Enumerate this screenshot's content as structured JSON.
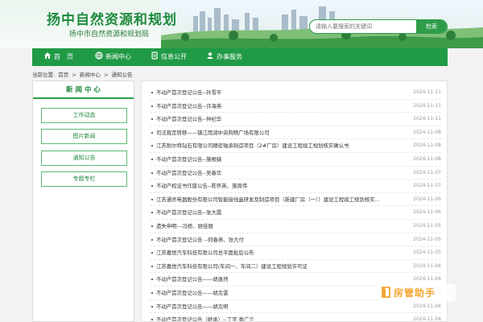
{
  "header": {
    "site_title": "扬中自然资源和规划",
    "site_subtitle": "扬中市自然资源和规划局"
  },
  "search": {
    "placeholder": "请输入要搜索的关键词",
    "button_label": "检索"
  },
  "nav": {
    "items": [
      {
        "label": "首　页",
        "icon": "home-icon"
      },
      {
        "label": "新闻中心",
        "icon": "globe-icon"
      },
      {
        "label": "信息公开",
        "icon": "document-icon"
      },
      {
        "label": "办事服务",
        "icon": "user-icon"
      }
    ]
  },
  "breadcrumb": {
    "prefix": "当前位置:",
    "items": [
      "首页",
      "新闻中心",
      "通知公告"
    ],
    "separator": ">"
  },
  "sidebar": {
    "title": "新 闻 中 心",
    "items": [
      "工作动态",
      "图片新闻",
      "通知公告",
      "专题专栏"
    ]
  },
  "list": {
    "items": [
      {
        "title": "不动产首次登记公告--孙雪平",
        "date": "2024-11-11"
      },
      {
        "title": "不动产首次登记公告--许海燕",
        "date": "2024-11-11"
      },
      {
        "title": "不动产首次登记公告--仲纪华",
        "date": "2024-11-11"
      },
      {
        "title": "司法裁定转移——镇江雨润中央购物广场有限公司",
        "date": "2024-11-08"
      },
      {
        "title": "江苏耐尔特钻石有限公司精密轴承制造项目（2#厂房）建设工程竣工规划核实确认书",
        "date": "2024-11-08"
      },
      {
        "title": "不动产首次登记公告--施根娣",
        "date": "2024-11-08"
      },
      {
        "title": "不动产首次登记公告--吴春华",
        "date": "2024-11-07"
      },
      {
        "title": "不动产权证书作废公告--陈怀英、施周伟",
        "date": "2024-11-07"
      },
      {
        "title": "江苏通灵电器股份有限公司智能接线盒研发及制造项目（新建厂房（一））建设工程竣工规划核实...",
        "date": "2024-11-06"
      },
      {
        "title": "不动产首次登记公告--张大霞",
        "date": "2024-11-06"
      },
      {
        "title": "遗失申明---冯桥、顾佳丽",
        "date": "2024-11-05"
      },
      {
        "title": "不动产首次登记公告 --何春燕、张大付",
        "date": "2024-11-05"
      },
      {
        "title": "江苏嘉悦汽车科技有限公司总平面批后公布",
        "date": "2024-11-05"
      },
      {
        "title": "江苏嘉悦汽车科技有限公司(车间一、车间二）建设工程规划许可证",
        "date": "2024-11-04"
      },
      {
        "title": "不动产首次登记公告——胡逸然",
        "date": "2024-11-04"
      },
      {
        "title": "不动产首次登记公告——胡克雷",
        "date": "2024-11-04"
      },
      {
        "title": "不动产首次登记公告——胡克明",
        "date": "2024-11-04"
      },
      {
        "title": "不动产首次登记公告（继承）--丁宇 季广兰",
        "date": "2024-11-04"
      }
    ]
  },
  "watermark": {
    "text": "房管助手"
  },
  "colors": {
    "primary_green": "#219a46",
    "title_green": "#1f8a3e",
    "watermark_orange": "#f3a531"
  }
}
